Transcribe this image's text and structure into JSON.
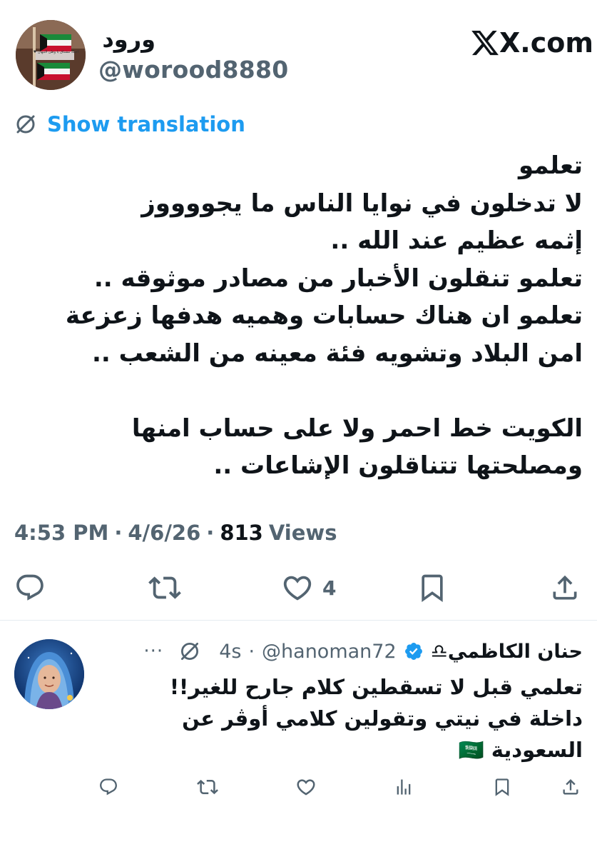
{
  "tweet": {
    "display_name": "ورود",
    "handle": "@worood8880",
    "avatar_caption": "أحبك مشتاق يا وطن التيهان ♥",
    "brand": "X.com",
    "translate_label": "Show translation",
    "lines": [
      "تعلمو",
      "لا تدخلون في نوايا الناس ما يجووووز",
      "إثمه عظيم عند الله ..",
      "تعلمو تنقلون الأخبار من مصادر موثوقه ..",
      "تعلمو ان هناك حسابات وهميه هدفها زعزعة",
      "امن البلاد وتشويه فئة معينه من الشعب ..",
      "",
      "الكويت خط احمر ولا على حساب امنها",
      "ومصلحتها تتناقلون الإشاعات .."
    ],
    "time": "4:53 PM",
    "date": "4/6/26",
    "views_count": "813",
    "views_label": "Views",
    "separator": "·",
    "like_count": "4"
  },
  "reply": {
    "display_name": "حنان الكاظمي♎",
    "handle": "@hanoman72",
    "separator": "·",
    "age": "4s",
    "more": "···",
    "lines": [
      "تعلمي قبل لا تسقطين كلام جارح للغير!!",
      "داخلة في نيتي وتقولين كلامي أوڤر عن",
      "السعودية 🇸🇦"
    ]
  },
  "colors": {
    "text": "#0f1419",
    "muted": "#536471",
    "link": "#1d9bf0",
    "verified": "#1d9bf0",
    "divider": "#e6ecf0"
  },
  "icons": [
    "x-logo-icon",
    "translate-icon",
    "reply-icon",
    "retweet-icon",
    "like-icon",
    "bookmark-icon",
    "share-icon",
    "verified-badge-icon",
    "no-translate-icon",
    "more-icon",
    "analytics-icon",
    "saudi-flag-icon"
  ]
}
